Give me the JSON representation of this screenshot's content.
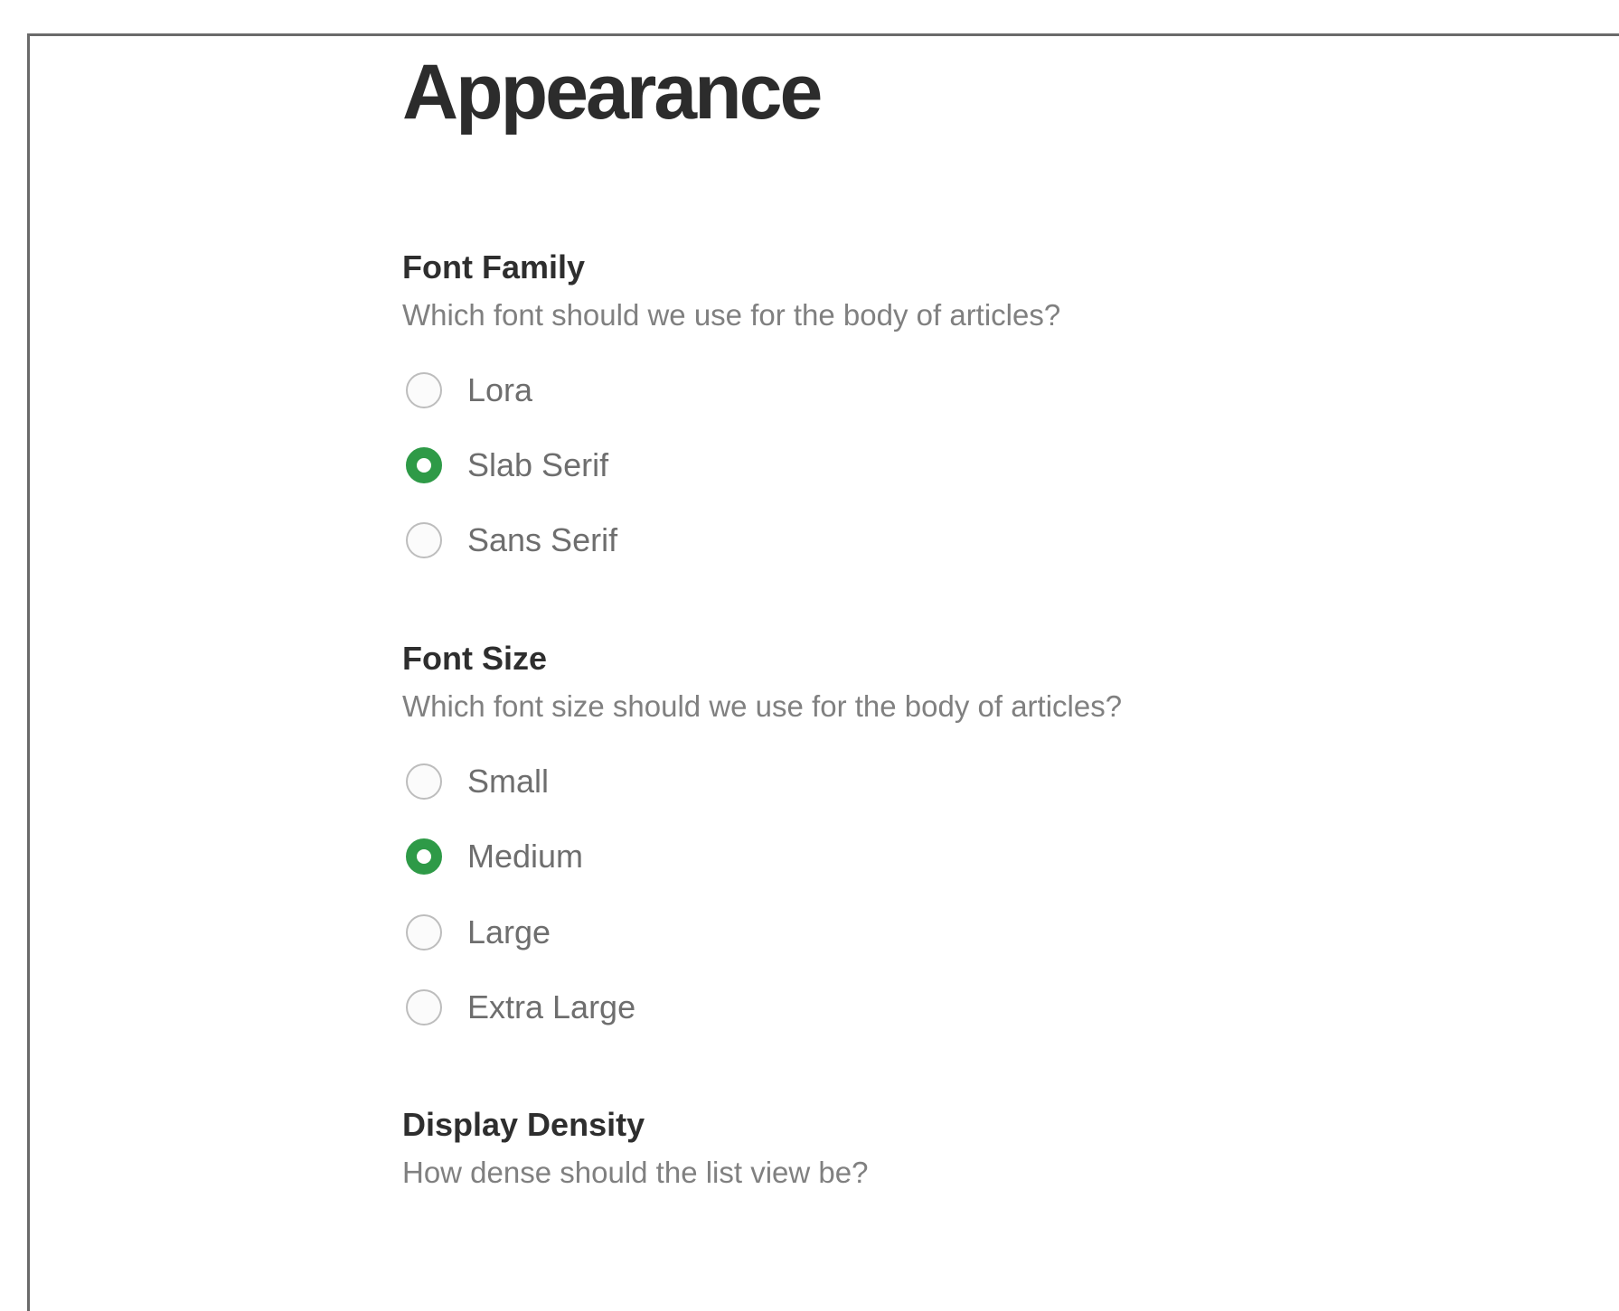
{
  "page": {
    "title": "Appearance"
  },
  "colors": {
    "accent": "#2e9a47",
    "title_text": "#2c2c2c",
    "description_text": "#808080",
    "option_text": "#6e6e6e"
  },
  "sections": {
    "font_family": {
      "title": "Font Family",
      "description": "Which font should we use for the body of articles?",
      "options": [
        {
          "label": "Lora",
          "checked": false
        },
        {
          "label": "Slab Serif",
          "checked": true
        },
        {
          "label": "Sans Serif",
          "checked": false
        }
      ]
    },
    "font_size": {
      "title": "Font Size",
      "description": "Which font size should we use for the body of articles?",
      "options": [
        {
          "label": "Small",
          "checked": false
        },
        {
          "label": "Medium",
          "checked": true
        },
        {
          "label": "Large",
          "checked": false
        },
        {
          "label": "Extra Large",
          "checked": false
        }
      ]
    },
    "display_density": {
      "title": "Display Density",
      "description": "How dense should the list view be?"
    }
  }
}
